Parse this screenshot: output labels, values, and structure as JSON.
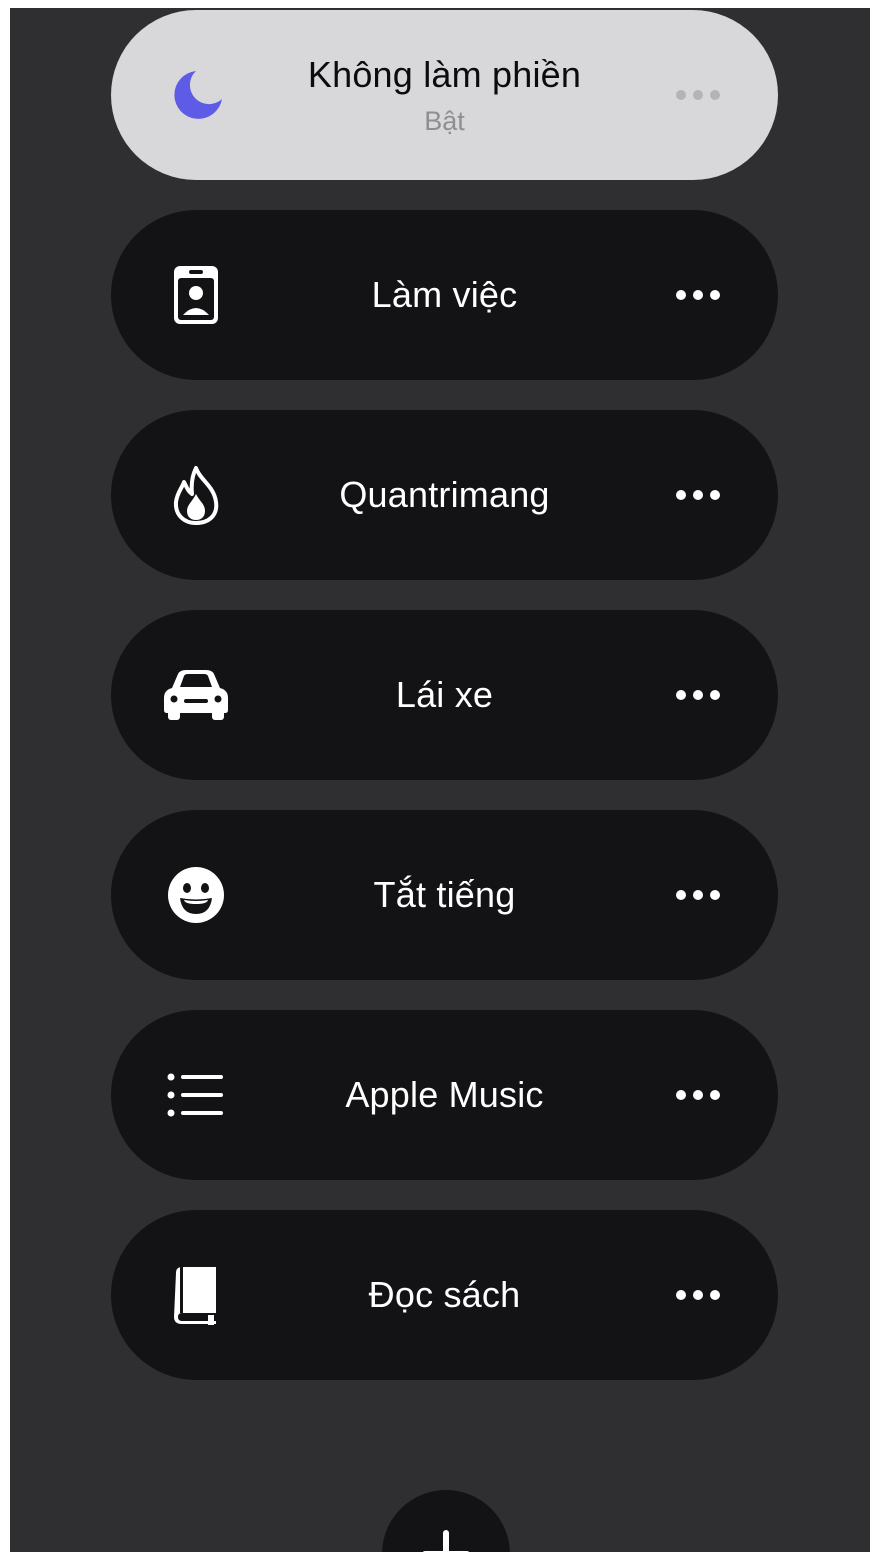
{
  "colors": {
    "background": "#2f2f31",
    "pill": "#131315",
    "active_pill": "#d8d8da",
    "moon_accent": "#5e5ce6"
  },
  "focus_modes": [
    {
      "label": "Không làm phiền",
      "status": "Bật",
      "icon": "moon-icon",
      "active": true
    },
    {
      "label": "Làm việc",
      "icon": "id-badge-icon",
      "active": false
    },
    {
      "label": "Quantrimang",
      "icon": "flame-icon",
      "active": false
    },
    {
      "label": "Lái xe",
      "icon": "car-icon",
      "active": false
    },
    {
      "label": "Tắt tiếng",
      "icon": "smiley-icon",
      "active": false
    },
    {
      "label": "Apple Music",
      "icon": "list-icon",
      "active": false
    },
    {
      "label": "Đọc sách",
      "icon": "book-icon",
      "active": false
    }
  ],
  "add_button": {
    "icon": "plus-icon"
  }
}
